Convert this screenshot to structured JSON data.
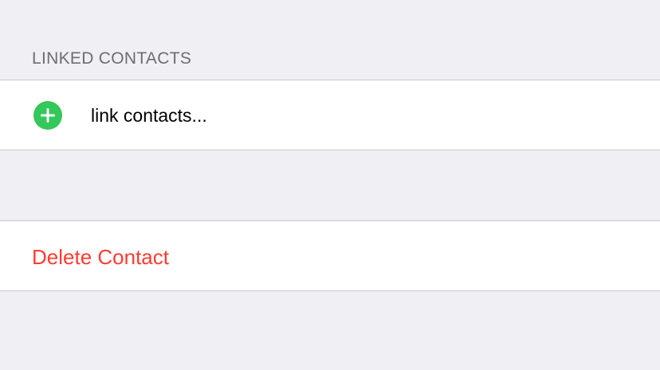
{
  "colors": {
    "background": "#efeff4",
    "add_icon": "#34c759",
    "destructive": "#ff3b30",
    "header_text": "#6d6d72",
    "separator": "#c8c7cc"
  },
  "linked_contacts": {
    "header": "LINKED CONTACTS",
    "add_icon": "plus-circle-icon",
    "link_label": "link contacts..."
  },
  "delete_section": {
    "delete_label": "Delete Contact"
  }
}
